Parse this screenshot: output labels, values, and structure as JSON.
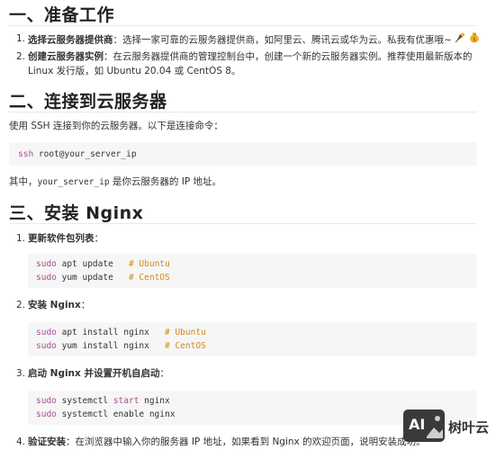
{
  "s1": {
    "heading": "一、准备工作",
    "items": [
      {
        "num": "1.",
        "bold": "选择云服务器提供商",
        "text_line1": "：选择一家可靠的云服务器提供商，如阿里云、腾讯云或华为云。私我有优惠哦~"
      },
      {
        "num": "2.",
        "bold": "创建云服务器实例",
        "text_line1": "：在云服务器提供商的管理控制台中，创建一个新的云服务器实例。推荐使用最新版本的",
        "text_line2": "Linux 发行版，如 Ubuntu 20.04 或 CentOS 8。"
      }
    ]
  },
  "s2": {
    "heading": "二、连接到云服务器",
    "intro": "使用 SSH 连接到你的云服务器。以下是连接命令：",
    "code": {
      "cmd": "ssh",
      "rest": " root@your_server_ip"
    },
    "note_pre": "其中，",
    "note_code": "your_server_ip",
    "note_post": " 是你云服务器的 IP 地址。"
  },
  "s3": {
    "heading": "三、安装 Nginx",
    "step1": {
      "num": "1.",
      "label": "更新软件包列表",
      "colon": "：",
      "lines": [
        {
          "sudo": "sudo",
          "cmd": " apt update   ",
          "comment": "# Ubuntu"
        },
        {
          "sudo": "sudo",
          "cmd": " yum update   ",
          "comment": "# CentOS"
        }
      ]
    },
    "step2": {
      "num": "2.",
      "label": "安装 Nginx",
      "colon": "：",
      "lines": [
        {
          "sudo": "sudo",
          "cmd": " apt install nginx   ",
          "comment": "# Ubuntu"
        },
        {
          "sudo": "sudo",
          "cmd": " yum install nginx   ",
          "comment": "# CentOS"
        }
      ]
    },
    "step3": {
      "num": "3.",
      "label": "启动 Nginx 并设置开机自启动",
      "colon": "：",
      "lines": [
        {
          "sudo": "sudo",
          "mid1": " systemctl ",
          "kw": "start",
          "rest": " nginx"
        },
        {
          "sudo": "sudo",
          "rest": " systemctl enable nginx"
        }
      ]
    },
    "step4": {
      "num": "4.",
      "label": "验证安装",
      "text": "：在浏览器中输入你的服务器 IP 地址，如果看到 Nginx 的欢迎页面，说明安装成功。"
    }
  },
  "watermark": {
    "badge": "AI",
    "name": "树叶云"
  },
  "colors": {
    "keyword": "#a5508f",
    "comment": "#d08a18",
    "code_bg": "#f6f6f6"
  }
}
